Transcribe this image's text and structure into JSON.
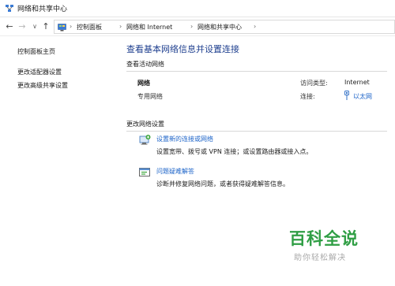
{
  "window": {
    "title": "网络和共享中心",
    "icon": "network-center-icon"
  },
  "address_bar": {
    "back": "back-arrow-icon",
    "forward": "forward-arrow-icon",
    "recent": "recent-locations-icon",
    "up": "up-arrow-icon",
    "breadcrumb": [
      "控制面板",
      "网络和 Internet",
      "网络和共享中心"
    ]
  },
  "sidebar": {
    "items": [
      {
        "label": "控制面板主页"
      },
      {
        "label": "更改适配器设置"
      },
      {
        "label": "更改高级共享设置"
      }
    ]
  },
  "main": {
    "heading": "查看基本网络信息并设置连接",
    "active_networks_label": "查看活动网络",
    "network": {
      "name": "网络",
      "type": "专用网络",
      "access_type_label": "访问类型:",
      "access_type_value": "Internet",
      "connections_label": "连接:",
      "connection_value": "以太网"
    },
    "change_settings_label": "更改网络设置",
    "tasks": [
      {
        "link": "设置新的连接或网络",
        "description": "设置宽带、拨号或 VPN 连接；或设置路由器或接入点。",
        "icon": "new-connection-icon"
      },
      {
        "link": "问题疑难解答",
        "description": "诊断并修复网络问题，或者获得疑难解答信息。",
        "icon": "troubleshoot-icon"
      }
    ]
  },
  "watermark": {
    "title": "百科全说",
    "subtitle": "助你轻松解决"
  },
  "colors": {
    "link": "#1d64c9",
    "heading": "#1e3f8f",
    "watermark_green": "#2f9e44"
  }
}
